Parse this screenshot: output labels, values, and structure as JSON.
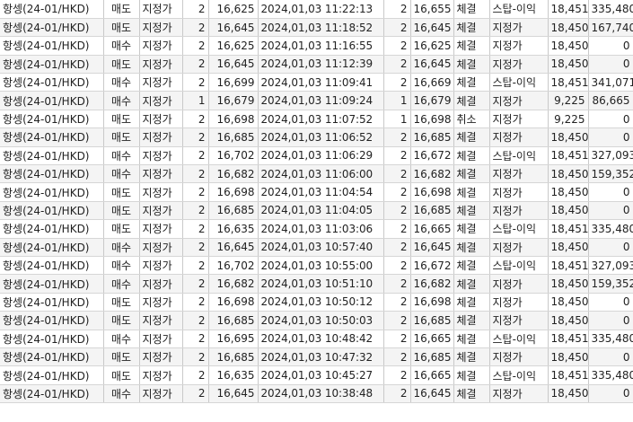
{
  "rows": [
    {
      "product": "항셍(24-01/HKD)",
      "side": "매도",
      "order_type": "지정가",
      "qty": "2",
      "price": "16,625",
      "datetime": "2024,01,03 11:22:13",
      "filled_qty": "2",
      "filled_price": "16,655",
      "status": "체결",
      "price_type": "스탑-이익",
      "ref_price": "18,451",
      "pnl": "335,480"
    },
    {
      "product": "항셍(24-01/HKD)",
      "side": "매도",
      "order_type": "지정가",
      "qty": "2",
      "price": "16,645",
      "datetime": "2024,01,03 11:18:52",
      "filled_qty": "2",
      "filled_price": "16,645",
      "status": "체결",
      "price_type": "지정가",
      "ref_price": "18,450",
      "pnl": "167,740"
    },
    {
      "product": "항셍(24-01/HKD)",
      "side": "매수",
      "order_type": "지정가",
      "qty": "2",
      "price": "16,625",
      "datetime": "2024,01,03 11:16:55",
      "filled_qty": "2",
      "filled_price": "16,625",
      "status": "체결",
      "price_type": "지정가",
      "ref_price": "18,450",
      "pnl": "0"
    },
    {
      "product": "항셍(24-01/HKD)",
      "side": "매도",
      "order_type": "지정가",
      "qty": "2",
      "price": "16,645",
      "datetime": "2024,01,03 11:12:39",
      "filled_qty": "2",
      "filled_price": "16,645",
      "status": "체결",
      "price_type": "지정가",
      "ref_price": "18,450",
      "pnl": "0"
    },
    {
      "product": "항셍(24-01/HKD)",
      "side": "매수",
      "order_type": "지정가",
      "qty": "2",
      "price": "16,699",
      "datetime": "2024,01,03 11:09:41",
      "filled_qty": "2",
      "filled_price": "16,669",
      "status": "체결",
      "price_type": "스탑-이익",
      "ref_price": "18,451",
      "pnl": "341,071"
    },
    {
      "product": "항셍(24-01/HKD)",
      "side": "매수",
      "order_type": "지정가",
      "qty": "1",
      "price": "16,679",
      "datetime": "2024,01,03 11:09:24",
      "filled_qty": "1",
      "filled_price": "16,679",
      "status": "체결",
      "price_type": "지정가",
      "ref_price": "9,225",
      "pnl": "86,665"
    },
    {
      "product": "항셍(24-01/HKD)",
      "side": "매도",
      "order_type": "지정가",
      "qty": "2",
      "price": "16,698",
      "datetime": "2024,01,03 11:07:52",
      "filled_qty": "1",
      "filled_price": "16,698",
      "status": "취소",
      "price_type": "지정가",
      "ref_price": "9,225",
      "pnl": "0"
    },
    {
      "product": "항셍(24-01/HKD)",
      "side": "매도",
      "order_type": "지정가",
      "qty": "2",
      "price": "16,685",
      "datetime": "2024,01,03 11:06:52",
      "filled_qty": "2",
      "filled_price": "16,685",
      "status": "체결",
      "price_type": "지정가",
      "ref_price": "18,450",
      "pnl": "0"
    },
    {
      "product": "항셍(24-01/HKD)",
      "side": "매수",
      "order_type": "지정가",
      "qty": "2",
      "price": "16,702",
      "datetime": "2024,01,03 11:06:29",
      "filled_qty": "2",
      "filled_price": "16,672",
      "status": "체결",
      "price_type": "스탑-이익",
      "ref_price": "18,451",
      "pnl": "327,093"
    },
    {
      "product": "항셍(24-01/HKD)",
      "side": "매수",
      "order_type": "지정가",
      "qty": "2",
      "price": "16,682",
      "datetime": "2024,01,03 11:06:00",
      "filled_qty": "2",
      "filled_price": "16,682",
      "status": "체결",
      "price_type": "지정가",
      "ref_price": "18,450",
      "pnl": "159,352"
    },
    {
      "product": "항셍(24-01/HKD)",
      "side": "매도",
      "order_type": "지정가",
      "qty": "2",
      "price": "16,698",
      "datetime": "2024,01,03 11:04:54",
      "filled_qty": "2",
      "filled_price": "16,698",
      "status": "체결",
      "price_type": "지정가",
      "ref_price": "18,450",
      "pnl": "0"
    },
    {
      "product": "항셍(24-01/HKD)",
      "side": "매도",
      "order_type": "지정가",
      "qty": "2",
      "price": "16,685",
      "datetime": "2024,01,03 11:04:05",
      "filled_qty": "2",
      "filled_price": "16,685",
      "status": "체결",
      "price_type": "지정가",
      "ref_price": "18,450",
      "pnl": "0"
    },
    {
      "product": "항셍(24-01/HKD)",
      "side": "매도",
      "order_type": "지정가",
      "qty": "2",
      "price": "16,635",
      "datetime": "2024,01,03 11:03:06",
      "filled_qty": "2",
      "filled_price": "16,665",
      "status": "체결",
      "price_type": "스탑-이익",
      "ref_price": "18,451",
      "pnl": "335,480"
    },
    {
      "product": "항셍(24-01/HKD)",
      "side": "매수",
      "order_type": "지정가",
      "qty": "2",
      "price": "16,645",
      "datetime": "2024,01,03 10:57:40",
      "filled_qty": "2",
      "filled_price": "16,645",
      "status": "체결",
      "price_type": "지정가",
      "ref_price": "18,450",
      "pnl": "0"
    },
    {
      "product": "항셍(24-01/HKD)",
      "side": "매수",
      "order_type": "지정가",
      "qty": "2",
      "price": "16,702",
      "datetime": "2024,01,03 10:55:00",
      "filled_qty": "2",
      "filled_price": "16,672",
      "status": "체결",
      "price_type": "스탑-이익",
      "ref_price": "18,451",
      "pnl": "327,093"
    },
    {
      "product": "항셍(24-01/HKD)",
      "side": "매수",
      "order_type": "지정가",
      "qty": "2",
      "price": "16,682",
      "datetime": "2024,01,03 10:51:10",
      "filled_qty": "2",
      "filled_price": "16,682",
      "status": "체결",
      "price_type": "지정가",
      "ref_price": "18,450",
      "pnl": "159,352"
    },
    {
      "product": "항셍(24-01/HKD)",
      "side": "매도",
      "order_type": "지정가",
      "qty": "2",
      "price": "16,698",
      "datetime": "2024,01,03 10:50:12",
      "filled_qty": "2",
      "filled_price": "16,698",
      "status": "체결",
      "price_type": "지정가",
      "ref_price": "18,450",
      "pnl": "0"
    },
    {
      "product": "항셍(24-01/HKD)",
      "side": "매도",
      "order_type": "지정가",
      "qty": "2",
      "price": "16,685",
      "datetime": "2024,01,03 10:50:03",
      "filled_qty": "2",
      "filled_price": "16,685",
      "status": "체결",
      "price_type": "지정가",
      "ref_price": "18,450",
      "pnl": "0"
    },
    {
      "product": "항셍(24-01/HKD)",
      "side": "매수",
      "order_type": "지정가",
      "qty": "2",
      "price": "16,695",
      "datetime": "2024,01,03 10:48:42",
      "filled_qty": "2",
      "filled_price": "16,665",
      "status": "체결",
      "price_type": "스탑-이익",
      "ref_price": "18,451",
      "pnl": "335,480"
    },
    {
      "product": "항셍(24-01/HKD)",
      "side": "매도",
      "order_type": "지정가",
      "qty": "2",
      "price": "16,685",
      "datetime": "2024,01,03 10:47:32",
      "filled_qty": "2",
      "filled_price": "16,685",
      "status": "체결",
      "price_type": "지정가",
      "ref_price": "18,450",
      "pnl": "0"
    },
    {
      "product": "항셍(24-01/HKD)",
      "side": "매도",
      "order_type": "지정가",
      "qty": "2",
      "price": "16,635",
      "datetime": "2024,01,03 10:45:27",
      "filled_qty": "2",
      "filled_price": "16,665",
      "status": "체결",
      "price_type": "스탑-이익",
      "ref_price": "18,451",
      "pnl": "335,480"
    },
    {
      "product": "항셍(24-01/HKD)",
      "side": "매수",
      "order_type": "지정가",
      "qty": "2",
      "price": "16,645",
      "datetime": "2024,01,03 10:38:48",
      "filled_qty": "2",
      "filled_price": "16,645",
      "status": "체결",
      "price_type": "지정가",
      "ref_price": "18,450",
      "pnl": "0"
    }
  ],
  "colors": {
    "sell": "#1f2fd6",
    "buy": "#d42a2a",
    "profit": "#d42a2a",
    "grid_line": "#c9c9c9"
  }
}
